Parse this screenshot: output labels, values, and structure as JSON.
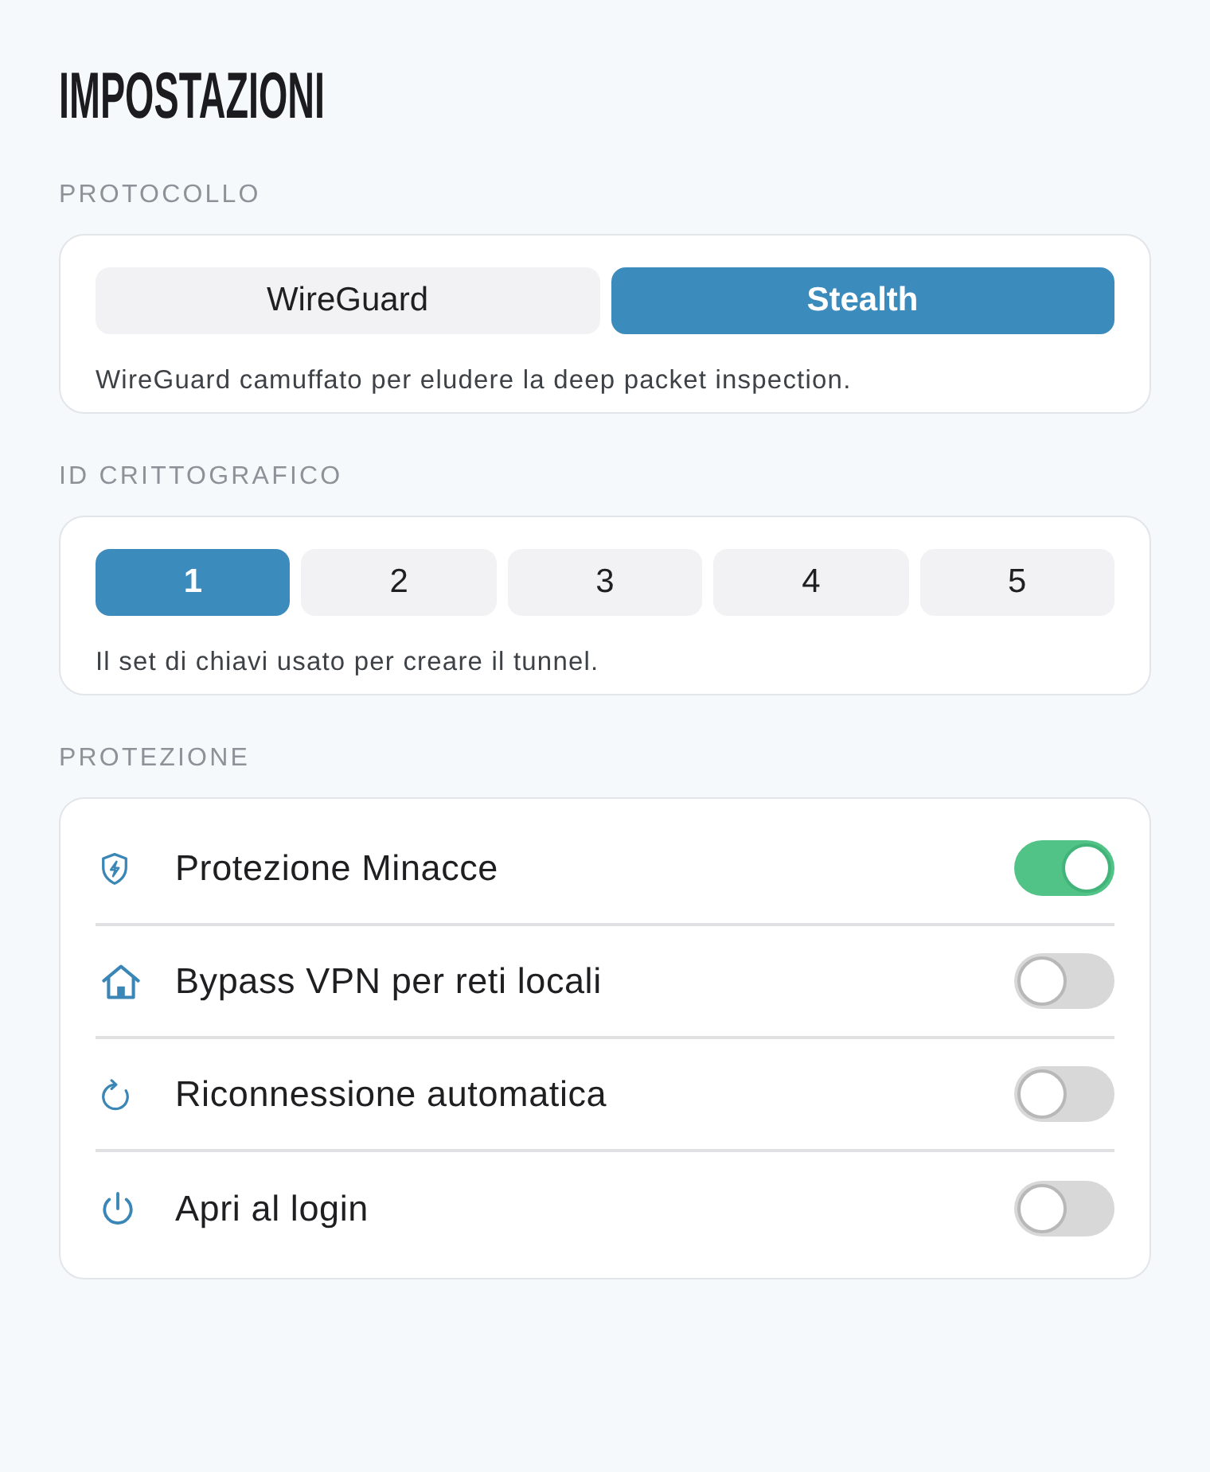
{
  "title": "IMPOSTAZIONI",
  "sections": [
    {
      "kind": "segmented",
      "label": "PROTOCOLLO",
      "options": [
        {
          "label": "WireGuard",
          "selected": false
        },
        {
          "label": "Stealth",
          "selected": true
        }
      ],
      "description": "WireGuard camuffato per eludere la deep packet inspection."
    },
    {
      "kind": "segmented",
      "label": "ID CRITTOGRAFICO",
      "options": [
        {
          "label": "1",
          "selected": true
        },
        {
          "label": "2",
          "selected": false
        },
        {
          "label": "3",
          "selected": false
        },
        {
          "label": "4",
          "selected": false
        },
        {
          "label": "5",
          "selected": false
        }
      ],
      "description": "Il set di chiavi usato per creare il tunnel."
    },
    {
      "kind": "toggles",
      "label": "PROTEZIONE",
      "items": [
        {
          "label": "Protezione Minacce",
          "on": true
        },
        {
          "label": "Bypass VPN per reti locali",
          "on": false
        },
        {
          "label": "Riconnessione automatica",
          "on": false
        },
        {
          "label": "Apri al login",
          "on": false
        }
      ]
    }
  ]
}
